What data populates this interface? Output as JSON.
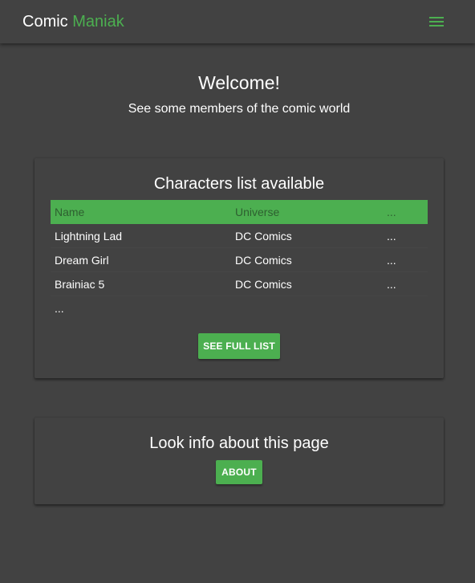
{
  "navbar": {
    "brand_first": "Comic",
    "brand_second": "Maniak",
    "menu_icon": "hamburger-menu-icon"
  },
  "welcome": {
    "title": "Welcome!",
    "subtitle": "See some members of the comic world"
  },
  "characters": {
    "title": "Characters list available",
    "headers": [
      "Name",
      "Universe",
      "..."
    ],
    "rows": [
      {
        "name": "Lightning Lad",
        "universe": "DC Comics",
        "more": "..."
      },
      {
        "name": "Dream Girl",
        "universe": "DC Comics",
        "more": "..."
      },
      {
        "name": "Brainiac 5",
        "universe": "DC Comics",
        "more": "..."
      }
    ],
    "ellipsis": "...",
    "button_label": "See full list"
  },
  "about": {
    "title": "Look info about this page",
    "button_label": "About"
  },
  "colors": {
    "background": "#424242",
    "accent": "#4caf50",
    "text": "#ffffff"
  }
}
